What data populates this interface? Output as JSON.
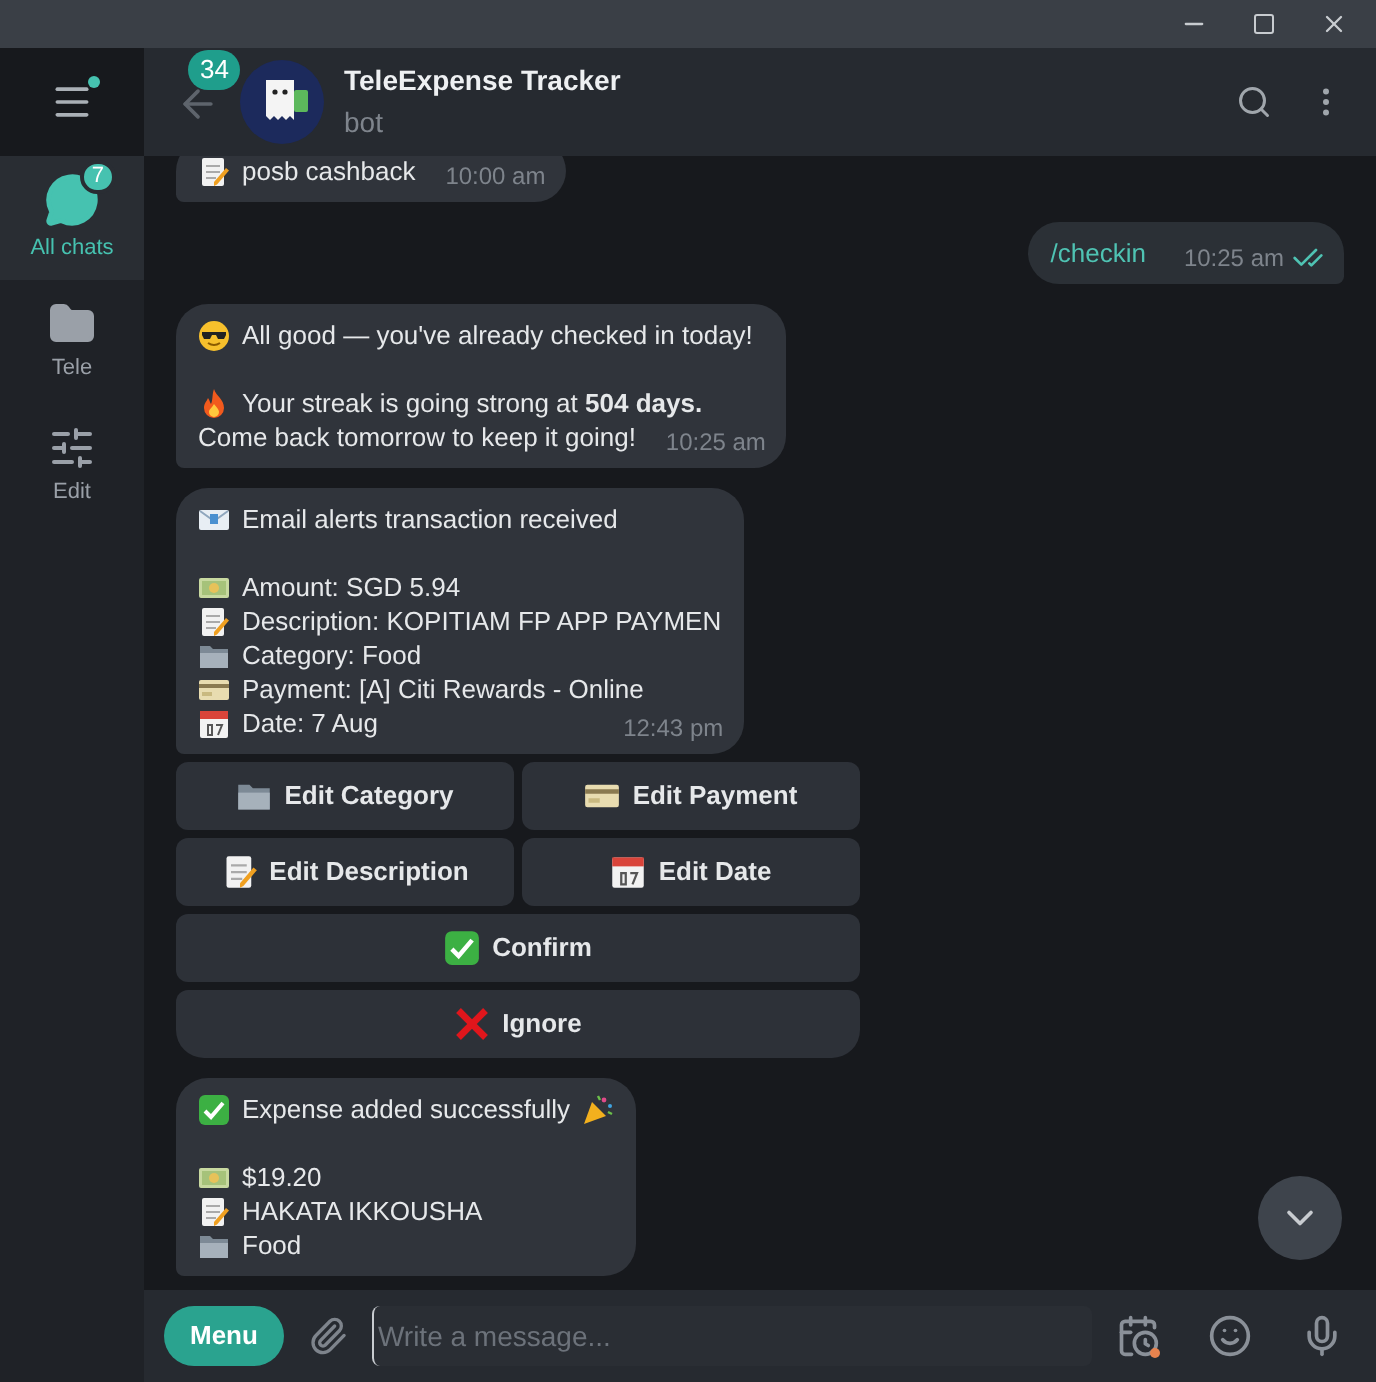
{
  "sidebar": {
    "items": [
      {
        "kind": "chats",
        "label": "All chats",
        "badge": "7",
        "selected": true
      },
      {
        "kind": "folder",
        "label": "Tele",
        "selected": false
      },
      {
        "kind": "edit",
        "label": "Edit",
        "selected": false
      }
    ]
  },
  "header": {
    "badge": "34",
    "title": "TeleExpense Tracker",
    "subtitle": "bot"
  },
  "messages": [
    {
      "kind": "incoming",
      "paragraphs": [
        [
          {
            "kind": "memo",
            "text": "posb cashback"
          }
        ]
      ],
      "time": "10:00 am"
    },
    {
      "kind": "outgoing",
      "paragraphs": [
        [
          {
            "kind": "command",
            "text": "/checkin"
          }
        ]
      ],
      "time": "10:25 am",
      "read": true
    },
    {
      "kind": "incoming",
      "paragraphs": [
        [
          {
            "kind": "sunglasses",
            "text": "All good — you've already checked in today!"
          }
        ],
        [
          {
            "kind": "fire",
            "text": "Your streak is going strong at **504 days.**"
          },
          {
            "kind": "plain",
            "text": "Come back tomorrow to keep it going!"
          }
        ]
      ],
      "time": "10:25 am"
    },
    {
      "kind": "incoming",
      "paragraphs": [
        [
          {
            "kind": "email",
            "text": "Email alerts transaction received"
          }
        ],
        [
          {
            "kind": "money",
            "text": "Amount: SGD 5.94"
          },
          {
            "kind": "memo",
            "text": "Description: KOPITIAM FP APP PAYMEN"
          },
          {
            "kind": "folder",
            "text": "Category: Food"
          },
          {
            "kind": "card",
            "text": "Payment: [A] Citi Rewards - Online"
          },
          {
            "kind": "calendar",
            "text": "Date: 7 Aug"
          }
        ]
      ],
      "time": "12:43 pm",
      "keyboard": [
        [
          {
            "kind": "folder",
            "label": "Edit Category"
          },
          {
            "kind": "card",
            "label": "Edit Payment"
          }
        ],
        [
          {
            "kind": "memo",
            "label": "Edit Description"
          },
          {
            "kind": "calendar",
            "label": "Edit Date"
          }
        ],
        [
          {
            "kind": "check",
            "label": "Confirm"
          }
        ],
        [
          {
            "kind": "cross",
            "label": "Ignore"
          }
        ]
      ]
    },
    {
      "kind": "incoming",
      "paragraphs": [
        [
          {
            "kind": "celebration",
            "text": "Expense added successfully"
          }
        ],
        [
          {
            "kind": "money",
            "text": "$19.20"
          },
          {
            "kind": "memo",
            "text": "HAKATA IKKOUSHA"
          },
          {
            "kind": "folder",
            "text": "Food"
          }
        ]
      ]
    }
  ],
  "composer": {
    "menu": "Menu",
    "placeholder": "Write a message..."
  }
}
